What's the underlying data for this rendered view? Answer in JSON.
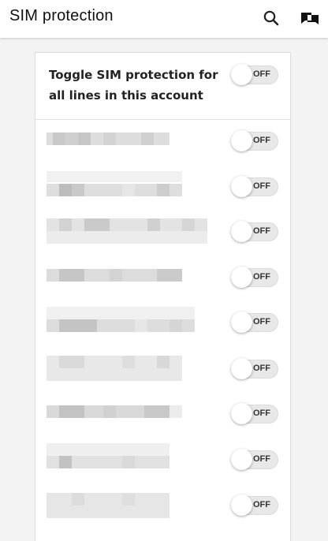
{
  "header": {
    "title": "SIM protection",
    "search_icon": "search-icon",
    "chat_icon": "chat-icon"
  },
  "master_toggle": {
    "label": "Toggle SIM protection for all lines in this account",
    "state": "OFF"
  },
  "lines": [
    {
      "state": "OFF"
    },
    {
      "state": "OFF"
    },
    {
      "state": "OFF"
    },
    {
      "state": "OFF"
    },
    {
      "state": "OFF"
    },
    {
      "state": "OFF"
    },
    {
      "state": "OFF"
    },
    {
      "state": "OFF"
    },
    {
      "state": "OFF"
    }
  ]
}
